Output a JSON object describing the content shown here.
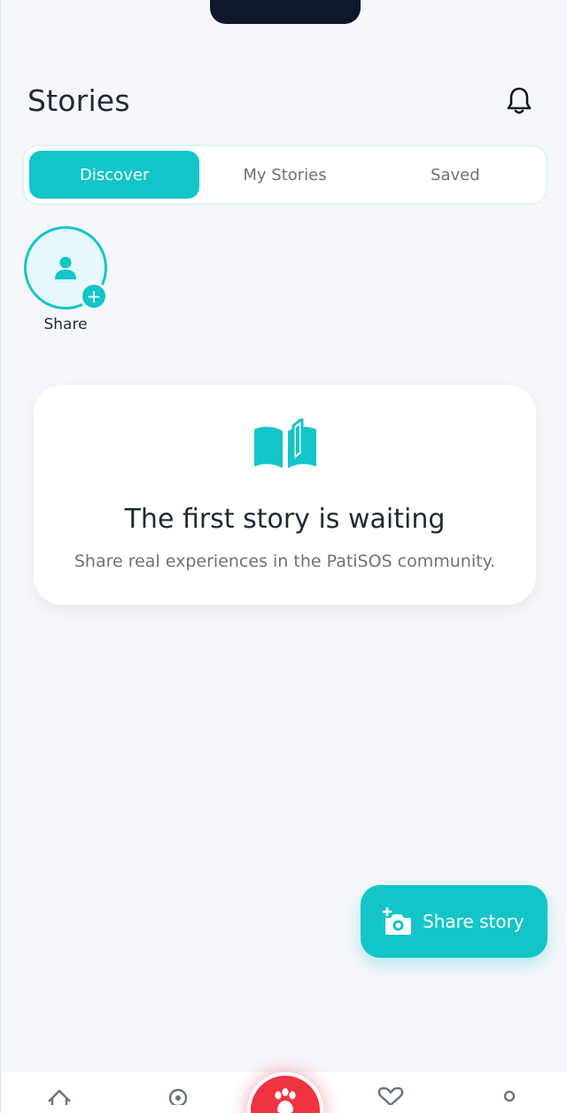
{
  "header": {
    "title": "Stories"
  },
  "tabs": [
    {
      "label": "Discover",
      "active": true
    },
    {
      "label": "My Stories",
      "active": false
    },
    {
      "label": "Saved",
      "active": false
    }
  ],
  "story_row": {
    "share_label": "Share"
  },
  "empty_state": {
    "icon": "open-book-icon",
    "title": "The first story is waiting",
    "subtitle": "Share real experiences in the PatiSOS community."
  },
  "fab": {
    "label": "Share story",
    "icon": "add-photo-icon"
  },
  "bottom_nav": {
    "items": [
      "home-icon",
      "location-pin-icon",
      "paw-icon",
      "heart-icon",
      "profile-icon"
    ],
    "center_color": "#ef3340"
  },
  "colors": {
    "accent": "#13c5c9",
    "text": "#1f2937",
    "muted": "#6b7280",
    "background": "#f5f7fa"
  }
}
